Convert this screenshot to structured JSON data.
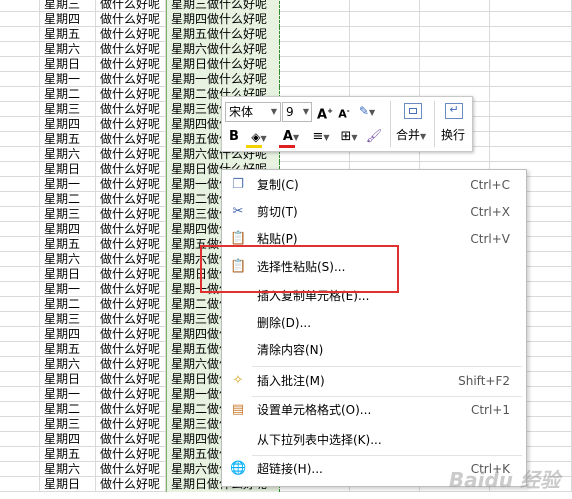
{
  "sheet": {
    "rows": [
      [
        "星期三",
        "做什么好呢",
        "星期三做什么好呢"
      ],
      [
        "星期四",
        "做什么好呢",
        "星期四做什么好呢"
      ],
      [
        "星期五",
        "做什么好呢",
        "星期五做什么好呢"
      ],
      [
        "星期六",
        "做什么好呢",
        "星期六做什么好呢"
      ],
      [
        "星期日",
        "做什么好呢",
        "星期日做什么好呢"
      ],
      [
        "星期一",
        "做什么好呢",
        "星期一做什么好呢"
      ],
      [
        "星期二",
        "做什么好呢",
        "星期二做什么好呢"
      ],
      [
        "星期三",
        "做什么好呢",
        "星期三做什么好呢"
      ],
      [
        "星期四",
        "做什么好呢",
        "星期四做什么好呢"
      ],
      [
        "星期五",
        "做什么好呢",
        "星期五做什么好呢"
      ],
      [
        "星期六",
        "做什么好呢",
        "星期六做什么好呢"
      ],
      [
        "星期日",
        "做什么好呢",
        "星期日做什么好呢"
      ],
      [
        "星期一",
        "做什么好呢",
        "星期一做什么好呢"
      ],
      [
        "星期二",
        "做什么好呢",
        "星期二做什么好呢"
      ],
      [
        "星期三",
        "做什么好呢",
        "星期三做什么好呢"
      ],
      [
        "星期四",
        "做什么好呢",
        "星期四做什么好呢"
      ],
      [
        "星期五",
        "做什么好呢",
        "星期五做什么好呢"
      ],
      [
        "星期六",
        "做什么好呢",
        "星期六做什么好呢"
      ],
      [
        "星期日",
        "做什么好呢",
        "星期日做什么好呢"
      ],
      [
        "星期一",
        "做什么好呢",
        "星期一做什么好呢"
      ],
      [
        "星期二",
        "做什么好呢",
        "星期二做什么好呢"
      ],
      [
        "星期三",
        "做什么好呢",
        "星期三做什么好呢"
      ],
      [
        "星期四",
        "做什么好呢",
        "星期四做什么好呢"
      ],
      [
        "星期五",
        "做什么好呢",
        "星期五做什么好呢"
      ],
      [
        "星期六",
        "做什么好呢",
        "星期六做什么好呢"
      ],
      [
        "星期日",
        "做什么好呢",
        "星期日做什么好呢"
      ],
      [
        "星期一",
        "做什么好呢",
        "星期一做什么好呢"
      ],
      [
        "星期二",
        "做什么好呢",
        "星期二做什么好呢"
      ],
      [
        "星期三",
        "做什么好呢",
        "星期三做什么好呢"
      ],
      [
        "星期四",
        "做什么好呢",
        "星期四做什么好呢"
      ],
      [
        "星期五",
        "做什么好呢",
        "星期五做什么好呢"
      ],
      [
        "星期六",
        "做什么好呢",
        "星期六做什么好呢"
      ],
      [
        "星期日",
        "做什么好呢",
        "星期日做什么好呢"
      ]
    ]
  },
  "toolbar": {
    "font_name": "宋体",
    "font_size": "9",
    "increase_font": "A",
    "decrease_font": "A",
    "bold": "B",
    "font_color": "A",
    "merge_label": "合并",
    "wrap_label": "换行"
  },
  "context_menu": {
    "items": [
      {
        "label": "复制(C)",
        "shortcut": "Ctrl+C",
        "icon": "copy-icon"
      },
      {
        "label": "剪切(T)",
        "shortcut": "Ctrl+X",
        "icon": "cut-icon"
      },
      {
        "label": "粘贴(P)",
        "shortcut": "Ctrl+V",
        "icon": "paste-icon"
      },
      {
        "label": "选择性粘贴(S)...",
        "shortcut": "",
        "icon": "paste-special-icon"
      },
      {
        "label": "插入复制单元格(E)...",
        "shortcut": "",
        "icon": ""
      },
      {
        "label": "删除(D)...",
        "shortcut": "",
        "icon": ""
      },
      {
        "label": "清除内容(N)",
        "shortcut": "",
        "icon": ""
      },
      {
        "label": "插入批注(M)",
        "shortcut": "Shift+F2",
        "icon": "comment-icon"
      },
      {
        "label": "设置单元格格式(O)...",
        "shortcut": "Ctrl+1",
        "icon": "format-cells-icon"
      },
      {
        "label": "从下拉列表中选择(K)...",
        "shortcut": "",
        "icon": ""
      },
      {
        "label": "超链接(H)...",
        "shortcut": "Ctrl+K",
        "icon": "hyperlink-icon"
      }
    ]
  },
  "watermark": "Baidu 经验",
  "colors": {
    "selection_fill": "#e7f2e1",
    "highlight_border": "#e0302f",
    "font_color_bar": "#e02020",
    "fill_color_bar": "#f2d200"
  }
}
